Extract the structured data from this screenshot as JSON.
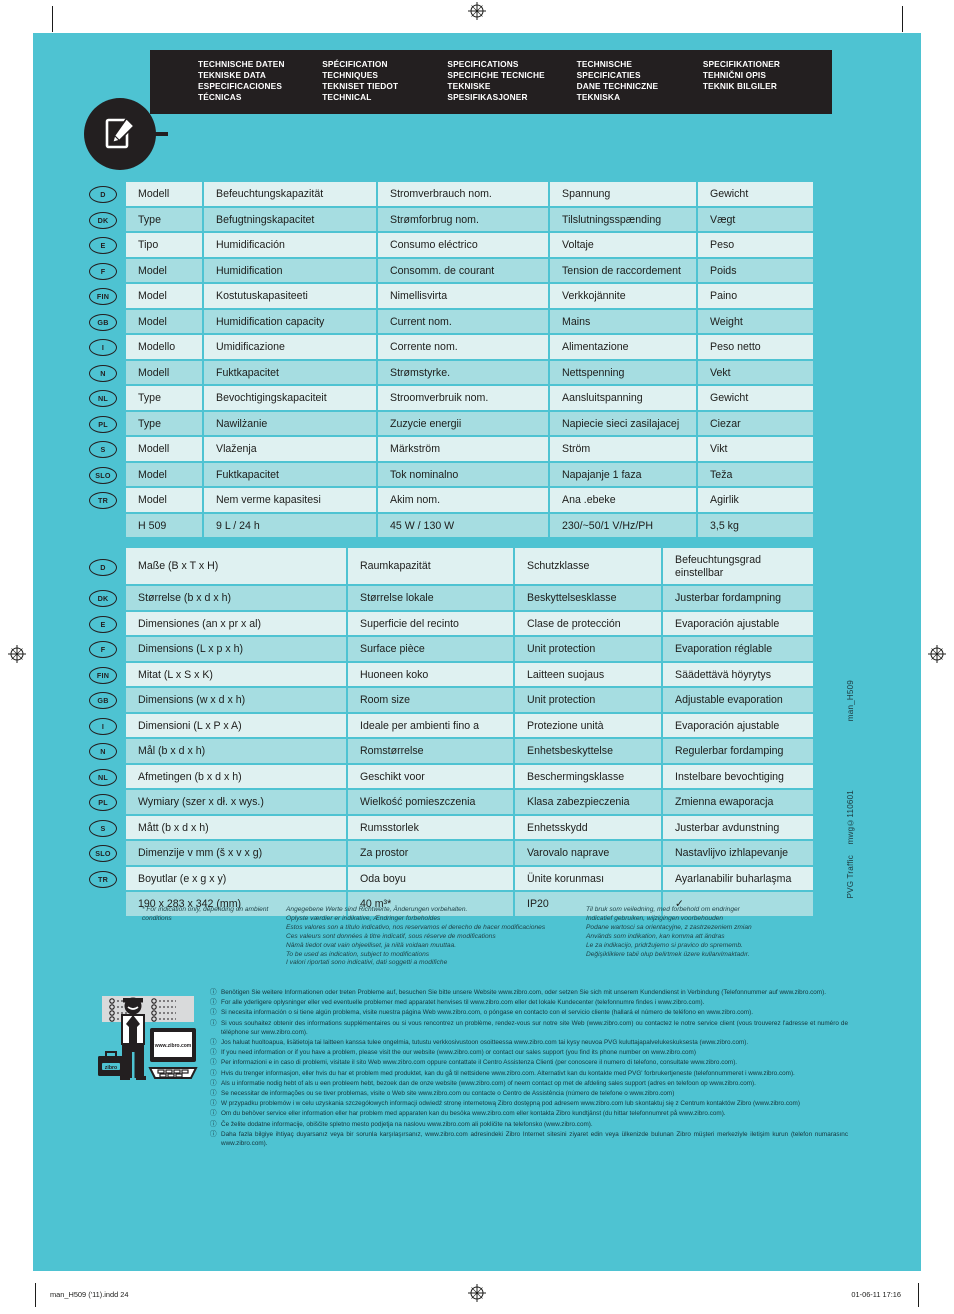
{
  "header": {
    "columns": [
      "TECHNISCHE DATEN\nTEKNISKE DATA\nESPECIFICACIONES\nTÉCNICAS",
      "SPÉCIFICATION\nTECHNIQUES\nTEKNISET TIEDOT\nTECHNICAL",
      "SPECIFICATIONS\nSPECIFICHE TECNICHE\nTEKNISKE\nSPESIFIKASJONER",
      "TECHNISCHE\nSPECIFICATIES\nDANE TECHNICZNE\nTEKNISKA",
      "SPECIFIKATIONER\nTEHNIČNI OPIS\nTEKNIK BILGILER"
    ]
  },
  "table1": {
    "rows": [
      {
        "flag": "D",
        "cells": [
          "Modell",
          "Befeuchtungskapazität",
          "Stromverbrauch nom.",
          "Spannung",
          "Gewicht"
        ]
      },
      {
        "flag": "DK",
        "cells": [
          "Type",
          "Befugtningskapacitet",
          "Strømforbrug nom.",
          "Tilslutningsspænding",
          "Vægt"
        ]
      },
      {
        "flag": "E",
        "cells": [
          "Tipo",
          "Humidificación",
          "Consumo eléctrico",
          "Voltaje",
          "Peso"
        ]
      },
      {
        "flag": "F",
        "cells": [
          "Model",
          "Humidification",
          "Consomm. de courant",
          "Tension de raccordement",
          "Poids"
        ]
      },
      {
        "flag": "FIN",
        "cells": [
          "Model",
          "Kostutuskapasiteeti",
          "Nimellisvirta",
          "Verkkojännite",
          "Paino"
        ]
      },
      {
        "flag": "GB",
        "cells": [
          "Model",
          "Humidification capacity",
          "Current nom.",
          "Mains",
          "Weight"
        ]
      },
      {
        "flag": "I",
        "cells": [
          "Modello",
          "Umidificazione",
          "Corrente nom.",
          "Alimentazione",
          "Peso netto"
        ]
      },
      {
        "flag": "N",
        "cells": [
          "Modell",
          "Fuktkapacitet",
          "Strømstyrke.",
          "Nettspenning",
          "Vekt"
        ]
      },
      {
        "flag": "NL",
        "cells": [
          "Type",
          "Bevochtigingskapaciteit",
          "Stroomverbruik nom.",
          "Aansluitspanning",
          "Gewicht"
        ]
      },
      {
        "flag": "PL",
        "cells": [
          "Type",
          "Nawilżanie",
          "Zuzycie energii",
          "Napiecie sieci zasilajacej",
          "Ciezar"
        ]
      },
      {
        "flag": "S",
        "cells": [
          "Modell",
          "Vlaženja",
          "Märkström",
          "Ström",
          "Vikt"
        ]
      },
      {
        "flag": "SLO",
        "cells": [
          "Model",
          "Fuktkapacitet",
          "Tok nominalno",
          "Napajanje 1 faza",
          "Teža"
        ]
      },
      {
        "flag": "TR",
        "cells": [
          "Model",
          "Nem verme kapasitesi",
          "Akim nom.",
          "Ana .ebeke",
          "Agirlik"
        ]
      },
      {
        "flag": "",
        "cells": [
          "H 509",
          "9 L / 24 h",
          "45 W / 130 W",
          "230/~50/1 V/Hz/PH",
          "3,5 kg"
        ]
      }
    ]
  },
  "table2": {
    "rows": [
      {
        "flag": "D",
        "cells": [
          "Maße (B x T x H)",
          "Raumkapazität",
          "Schutzklasse",
          "Befeuchtungsgrad einstellbar"
        ]
      },
      {
        "flag": "DK",
        "cells": [
          "Størrelse (b x d x h)",
          "Størrelse lokale",
          "Beskyttelsesklasse",
          "Justerbar fordampning"
        ]
      },
      {
        "flag": "E",
        "cells": [
          "Dimensiones (an x pr x al)",
          "Superficie del recinto",
          "Clase de protección",
          "Evaporación ajustable"
        ]
      },
      {
        "flag": "F",
        "cells": [
          "Dimensions (L x p x h)",
          "Surface pièce",
          "Unit protection",
          "Evaporation réglable"
        ]
      },
      {
        "flag": "FIN",
        "cells": [
          "Mitat (L x S x K)",
          "Huoneen koko",
          "Laitteen suojaus",
          "Säädettävä höyrytys"
        ]
      },
      {
        "flag": "GB",
        "cells": [
          "Dimensions (w x d x h)",
          "Room size",
          "Unit protection",
          "Adjustable evaporation"
        ]
      },
      {
        "flag": "I",
        "cells": [
          "Dimensioni (L x P x A)",
          "Ideale per ambienti fino a",
          "Protezione unità",
          "Evaporación ajustable"
        ]
      },
      {
        "flag": "N",
        "cells": [
          "Mål (b x d x h)",
          "Romstørrelse",
          "Enhetsbeskyttelse",
          "Regulerbar fordamping"
        ]
      },
      {
        "flag": "NL",
        "cells": [
          "Afmetingen (b x d x h)",
          "Geschikt voor",
          "Beschermingsklasse",
          "Instelbare bevochtiging"
        ]
      },
      {
        "flag": "PL",
        "cells": [
          "Wymiary (szer x dł. x wys.)",
          "Wielkość pomieszczenia",
          "Klasa zabezpieczenia",
          "Zmienna ewaporacja"
        ]
      },
      {
        "flag": "S",
        "cells": [
          "Mått (b x d x h)",
          "Rumsstorlek",
          "Enhetsskydd",
          "Justerbar avdunstning"
        ]
      },
      {
        "flag": "SLO",
        "cells": [
          "Dimenzije v mm (š x v x g)",
          "Za prostor",
          "Varovalo naprave",
          "Nastavlijvo izhlapevanje"
        ]
      },
      {
        "flag": "TR",
        "cells": [
          "Boyutlar (e x g x y)",
          "Oda boyu",
          "Ünite korunması",
          "Ayarlanabilir buharlaşma"
        ]
      },
      {
        "flag": "",
        "cells": [
          "190 x 283 x 342 (mm)",
          "40 m³*",
          "IP20",
          "✓"
        ]
      }
    ]
  },
  "notes": {
    "col0": "* For indication only, depending on ambient conditions",
    "col1": "Angegebene Werte sind Richtwerte, Änderungen vorbehalten.\nOplyste værdier er indikative, Ændringer forbeholdes\nEstos valores son a título indicativo, nos reservamos el derecho de hacer modificaciones\nCes valeurs sont données à titre indicatif, sous réserve de modifications\nNämä tiedot ovat vain ohjeelliset, ja niitä voidaan muuttaa.\nTo be used as indication, subject to modifications\nI valori riportati sono indicativi, dati soggetti a modifiche",
    "col2": "Til bruk som veiledning, med forbehold om endringer\nIndicatief gebruiken, wijzigingen voorbehouden\nPodane wartosci sa orientacyjne, z zastrzezeniem zmian\nAnvänds som indikation, kan komma att ändras\nLe za indikacijo, pridržujemo si pravico do sprememb.\nDeğişikliklere tabii olup belirtmek üzere kullanılmaktadır."
  },
  "illustration": {
    "screen_text": "www.zibro.com",
    "case_text": "zibro"
  },
  "service": {
    "items": [
      {
        "mark": "D",
        "text": "Benötigen Sie weitere Informationen oder treten Probleme auf, besuchen Sie bitte unsere Website www.zibro.com, oder setzen Sie sich mit unserem Kundendienst in Verbindung (Telefonnummer auf www.zibro.com)."
      },
      {
        "mark": "DK",
        "text": "For alle yderligere oplysninger eller ved eventuelle problemer med apparatet henvises til www.zibro.com eller det lokale Kundecenter (telefonnumre findes i www.zibro.com)."
      },
      {
        "mark": "E",
        "text": "Si necesita información o si tiene algún problema, visite nuestra página Web www.zibro.com, o póngase en contacto con el servicio cliente (hallará el número de teléfono en www.zibro.com)."
      },
      {
        "mark": "F",
        "text": "Si vous souhaitez obtenir des informations supplémentaires ou si vous rencontrez un problème, rendez-vous sur notre site Web (www.zibro.com) ou contactez le notre service client (vous trouverez l'adresse et numéro de téléphone sur www.zibro.com)."
      },
      {
        "mark": "FIN",
        "text": "Jos haluat huoltoapua, lisätietoja tai laitteen kanssa tulee ongelmia, tutustu verkkosivustoon osoitteessa www.zibro.com tai kysy neuvoa PVG kuluttajapalvelukeskuksesta (www.zibro.com)."
      },
      {
        "mark": "GB",
        "text": "If you need information or if you have a problem, please visit the our website (www.zibro.com) or contact our sales support (you find its phone number on www.zibro.com)"
      },
      {
        "mark": "I",
        "text": "Per informazioni e in caso di problemi, visitate il sito Web www.zibro.com oppure contattate il Centro Assistenza Clienti (per conoscere il numero di telefono, consultate www.zibro.com)."
      },
      {
        "mark": "N",
        "text": "Hvis du trenger informasjon, eller hvis du har et problem med produktet, kan du gå til nettsidene www.zibro.com. Alternativt kan du kontakte med PVG' forbrukertjeneste (telefonnummeret i www.zibro.com)."
      },
      {
        "mark": "NL",
        "text": "Als u informatie nodig hebt of als u een probleem hebt, bezoek dan de onze website (www.zibro.com) of neem contact op met de afdeling sales support (adres en telefoon op www.zibro.com)."
      },
      {
        "mark": "P",
        "text": "Se necessitar de informações ou se tiver problemas, visite o Web site www.zibro.com ou contacte o Centro de Assistência (número de telefone o www.zibro.com)"
      },
      {
        "mark": "PL",
        "text": "W przypadku problemów i w celu uzyskania szczegółowych informacji odwiedź stronę internetową Zibro dostępną pod adresem www.zibro.com lub skontaktuj się z Centrum kontaktów Zibro (www.zibro.com)"
      },
      {
        "mark": "S",
        "text": "Om du behöver service eller information eller har problem med apparaten kan du besöka www.zibro.com eller kontakta Zibro kundtjänst (du hittar telefonnumret på www.zibro.com)."
      },
      {
        "mark": "SLO",
        "text": "Če želite dodatne informacije, obiščite spletno mesto podjetja na naslovu www.zibro.com ali pokličite na telefonsko (www.zibro.com)."
      },
      {
        "mark": "TR",
        "text": "Daha fazla bilgiye ihtiyaç duyarsanız veya bir sorunla karşılaşırsanız, www.zibro.com adresindeki Zibro Internet sitesini ziyaret edin veya ülkenizde bulunan Zibro müşteri merkeziyle iletişim kurun (telefon numarasınc www.zibro.com)."
      }
    ]
  },
  "side_labels": {
    "manual": "man_H509",
    "code": "mwg©110601",
    "company": "PVG Traffic"
  },
  "footer": {
    "file": "man_H509 ('11).indd   24",
    "timestamp": "01-06-11   17:16"
  },
  "colors": {
    "teal": "#4ec3d2",
    "row_light": "#dff1f1",
    "row_dark": "#a6dde1",
    "ink": "#231f20"
  }
}
